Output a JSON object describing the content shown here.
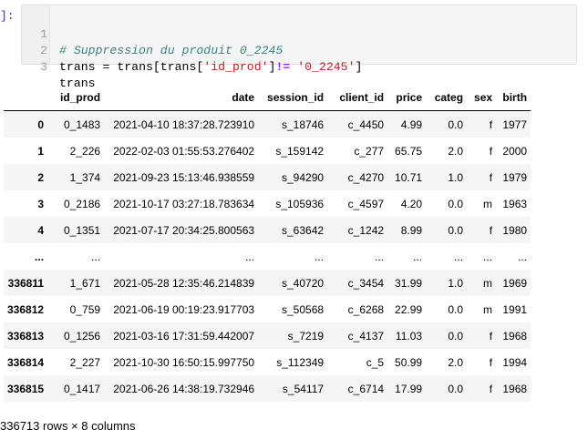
{
  "cell": {
    "prompt": "]:",
    "lines": [
      {
        "num": "1",
        "comment": "# Suppression du produit 0_2245"
      },
      {
        "num": "2",
        "lhs": "trans",
        "eq": " = ",
        "pre": "trans[trans[",
        "key": "'id_prod'",
        "mid": "]",
        "neq": "!=",
        "sp": " ",
        "val": "'0_2245'",
        "end": "]"
      },
      {
        "num": "3",
        "text": "trans"
      }
    ]
  },
  "table": {
    "columns": [
      "",
      "id_prod",
      "date",
      "session_id",
      "client_id",
      "price",
      "categ",
      "sex",
      "birth"
    ],
    "rows": [
      {
        "index": "0",
        "cells": [
          "0_1483",
          "2021-04-10 18:37:28.723910",
          "s_18746",
          "c_4450",
          "4.99",
          "0.0",
          "f",
          "1977"
        ]
      },
      {
        "index": "1",
        "cells": [
          "2_226",
          "2022-02-03 01:55:53.276402",
          "s_159142",
          "c_277",
          "65.75",
          "2.0",
          "f",
          "2000"
        ]
      },
      {
        "index": "2",
        "cells": [
          "1_374",
          "2021-09-23 15:13:46.938559",
          "s_94290",
          "c_4270",
          "10.71",
          "1.0",
          "f",
          "1979"
        ]
      },
      {
        "index": "3",
        "cells": [
          "0_2186",
          "2021-10-17 03:27:18.783634",
          "s_105936",
          "c_4597",
          "4.20",
          "0.0",
          "m",
          "1963"
        ]
      },
      {
        "index": "4",
        "cells": [
          "0_1351",
          "2021-07-17 20:34:25.800563",
          "s_63642",
          "c_1242",
          "8.99",
          "0.0",
          "f",
          "1980"
        ]
      },
      {
        "index": "...",
        "cells": [
          "...",
          "...",
          "...",
          "...",
          "...",
          "...",
          "...",
          "..."
        ]
      },
      {
        "index": "336811",
        "cells": [
          "1_671",
          "2021-05-28 12:35:46.214839",
          "s_40720",
          "c_3454",
          "31.99",
          "1.0",
          "m",
          "1969"
        ]
      },
      {
        "index": "336812",
        "cells": [
          "0_759",
          "2021-06-19 00:19:23.917703",
          "s_50568",
          "c_6268",
          "22.99",
          "0.0",
          "m",
          "1991"
        ]
      },
      {
        "index": "336813",
        "cells": [
          "0_1256",
          "2021-03-16 17:31:59.442007",
          "s_7219",
          "c_4137",
          "11.03",
          "0.0",
          "f",
          "1968"
        ]
      },
      {
        "index": "336814",
        "cells": [
          "2_227",
          "2021-10-30 16:50:15.997750",
          "s_112349",
          "c_5",
          "50.99",
          "2.0",
          "f",
          "1994"
        ]
      },
      {
        "index": "336815",
        "cells": [
          "0_1417",
          "2021-06-26 14:38:19.732946",
          "s_54117",
          "c_6714",
          "17.99",
          "0.0",
          "f",
          "1968"
        ]
      }
    ]
  },
  "footer": {
    "shape": "336713 rows × 8 columns"
  }
}
